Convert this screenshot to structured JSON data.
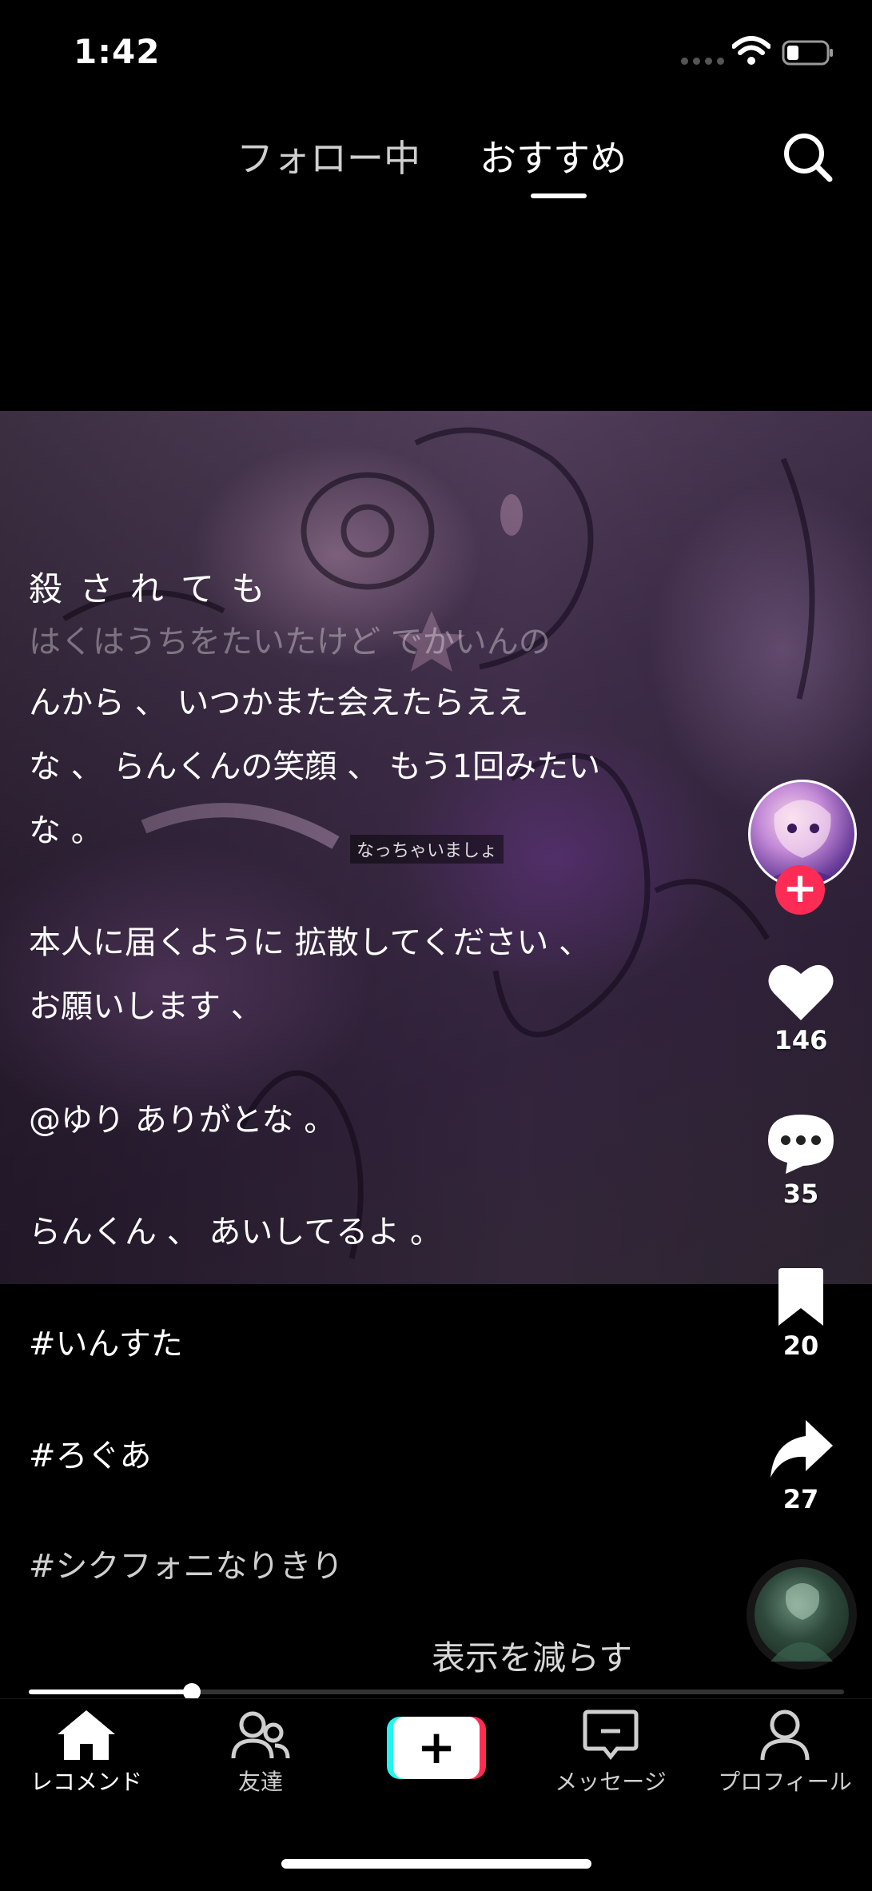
{
  "status_bar": {
    "time": "1:42"
  },
  "top_nav": {
    "tab_following": "フォロー中",
    "tab_for_you": "おすすめ"
  },
  "video": {
    "caption_overlay": "なっちゃいましょ"
  },
  "description": {
    "lines": [
      "殺 さ れ て も",
      "はくはうちをたいたけど でかいんの",
      "んから 、 いつかまた会えたらええ",
      "な 、 らんくんの笑顔 、 もう1回みたい",
      "な 。",
      "本人に届くように 拡散してください 、",
      "お願いします 、",
      "@ゆり ありがとな 。",
      "らんくん 、 あいしてるよ 。"
    ],
    "hashtags": [
      "#いんすた",
      "#ろぐあ",
      "#シクフォニなりきり"
    ],
    "show_less": "表示を減らす"
  },
  "actions": {
    "likes": "146",
    "comments": "35",
    "saves": "20",
    "shares": "27"
  },
  "playback": {
    "progress": 0.2
  },
  "tab_bar": {
    "home": "レコメンド",
    "friends": "友達",
    "messages": "メッセージ",
    "profile": "プロフィール",
    "create_symbol": "+"
  },
  "colors": {
    "accent": "#fe2c55",
    "cyan": "#25f4ee"
  }
}
